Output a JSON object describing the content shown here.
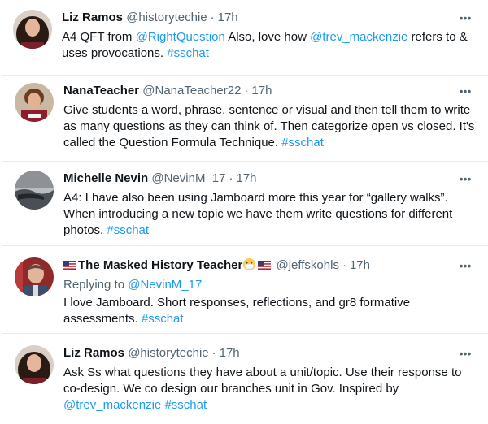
{
  "tweets": [
    {
      "author": "Liz Ramos",
      "handle": "@historytechie",
      "time": "17h",
      "text_parts": [
        "A4 QFT from ",
        "@RightQuestion",
        " Also, love how ",
        "@trev_mackenzie",
        " refers to & uses provocations. ",
        "#sschat"
      ]
    },
    {
      "author": "NanaTeacher",
      "handle": "@NanaTeacher22",
      "time": "17h",
      "text_parts": [
        "Give students a word, phrase, sentence or visual and then tell them to write as many questions as they can think of.  Then categorize open vs closed. It's called the Question Formula Technique. ",
        "#sschat"
      ]
    },
    {
      "author": "Michelle Nevin",
      "handle": "@NevinM_17",
      "time": "17h",
      "text_parts": [
        "A4: I have also been using Jamboard more this year for “gallery walks”. When introducing a new topic we have them write questions for different photos.  ",
        "#sschat"
      ]
    },
    {
      "author": "The Masked History Teacher",
      "handle": "@jeffskohls",
      "time": "17h",
      "replying_label": "Replying to ",
      "replying_to": "@NevinM_17",
      "text_parts": [
        "I love Jamboard. Short responses, reflections, and gr8 formative assessments. ",
        "#sschat"
      ]
    },
    {
      "author": "Liz Ramos",
      "handle": "@historytechie",
      "time": "17h",
      "text_parts": [
        "Ask Ss what questions they have about a unit/topic. Use their response to co-design. We co design our branches unit in Gov. Inspired by ",
        "@trev_mackenzie",
        " ",
        "#sschat"
      ]
    }
  ],
  "ui": {
    "dot_separator": "·",
    "more_label": "•••"
  },
  "colors": {
    "link": "#1d9bf0",
    "secondary_text": "#536471",
    "primary_text": "#0f1419",
    "divider": "#eff3f4"
  },
  "icons": {
    "more": "more-options-icon",
    "flag": "us-flag-icon",
    "mask": "face-with-mask-icon"
  }
}
